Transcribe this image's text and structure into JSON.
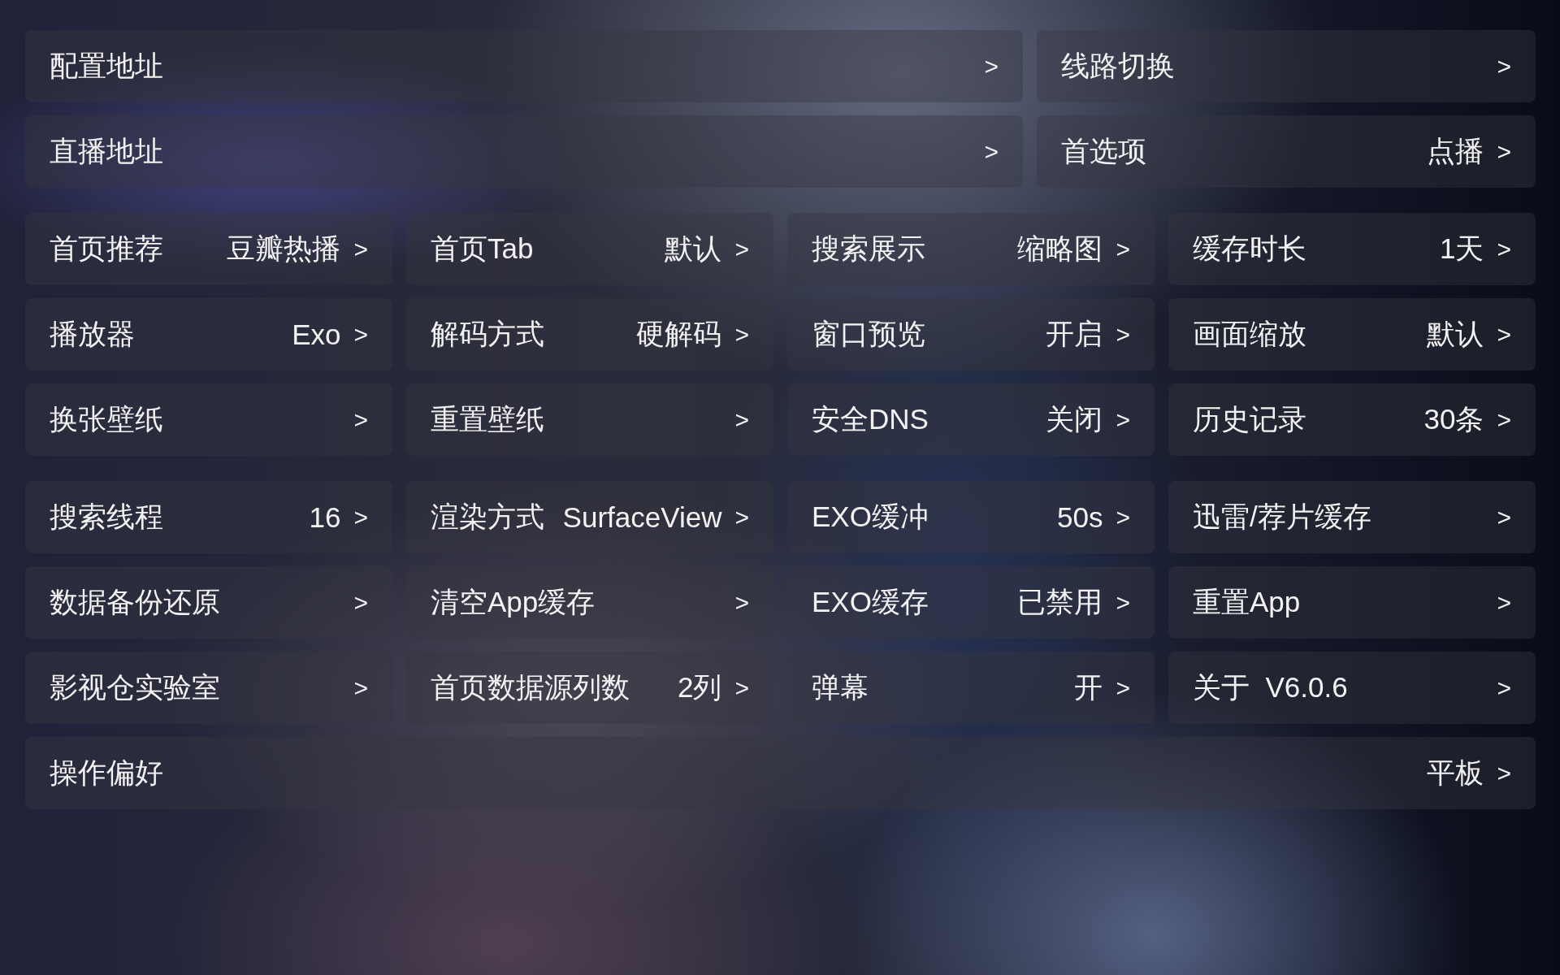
{
  "sections": [
    {
      "rows": [
        {
          "items": [
            {
              "label": "配置地址",
              "arrow": ">"
            },
            {
              "label": "线路切换",
              "arrow": ">"
            }
          ]
        },
        {
          "items": [
            {
              "label": "直播地址",
              "arrow": ">"
            },
            {
              "label": "首选项",
              "value": "点播",
              "arrow": ">"
            }
          ]
        }
      ]
    },
    {
      "rows": [
        {
          "items": [
            {
              "label": "首页推荐",
              "value": "豆瓣热播",
              "arrow": ">"
            },
            {
              "label": "首页Tab",
              "value": "默认",
              "arrow": ">"
            },
            {
              "label": "搜索展示",
              "value": "缩略图",
              "arrow": ">"
            },
            {
              "label": "缓存时长",
              "value": "1天",
              "arrow": ">"
            }
          ]
        },
        {
          "items": [
            {
              "label": "播放器",
              "value": "Exo",
              "arrow": ">"
            },
            {
              "label": "解码方式",
              "value": "硬解码",
              "arrow": ">"
            },
            {
              "label": "窗口预览",
              "value": "开启",
              "arrow": ">"
            },
            {
              "label": "画面缩放",
              "value": "默认",
              "arrow": ">"
            }
          ]
        },
        {
          "items": [
            {
              "label": "换张壁纸",
              "arrow": ">"
            },
            {
              "label": "重置壁纸",
              "arrow": ">"
            },
            {
              "label": "安全DNS",
              "value": "关闭",
              "arrow": ">"
            },
            {
              "label": "历史记录",
              "value": "30条",
              "arrow": ">"
            }
          ]
        }
      ]
    },
    {
      "rows": [
        {
          "items": [
            {
              "label": "搜索线程",
              "value": "16",
              "arrow": ">"
            },
            {
              "label": "渲染方式",
              "value": "SurfaceView",
              "arrow": ">"
            },
            {
              "label": "EXO缓冲",
              "value": "50s",
              "arrow": ">"
            },
            {
              "label": "迅雷/荐片缓存",
              "arrow": ">"
            }
          ]
        },
        {
          "items": [
            {
              "label": "数据备份还原",
              "arrow": ">"
            },
            {
              "label": "清空App缓存",
              "arrow": ">"
            },
            {
              "label": "EXO缓存",
              "value": "已禁用",
              "arrow": ">"
            },
            {
              "label": "重置App",
              "arrow": ">"
            }
          ]
        },
        {
          "items": [
            {
              "label": "影视仓实验室",
              "arrow": ">"
            },
            {
              "label": "首页数据源列数",
              "value": "2列",
              "arrow": ">"
            },
            {
              "label": "弹幕",
              "value": "开",
              "arrow": ">"
            },
            {
              "label": "关于  V6.0.6",
              "arrow": ">"
            }
          ]
        },
        {
          "items": [
            {
              "label": "操作偏好",
              "value": "平板",
              "arrow": ">"
            }
          ]
        }
      ]
    }
  ]
}
